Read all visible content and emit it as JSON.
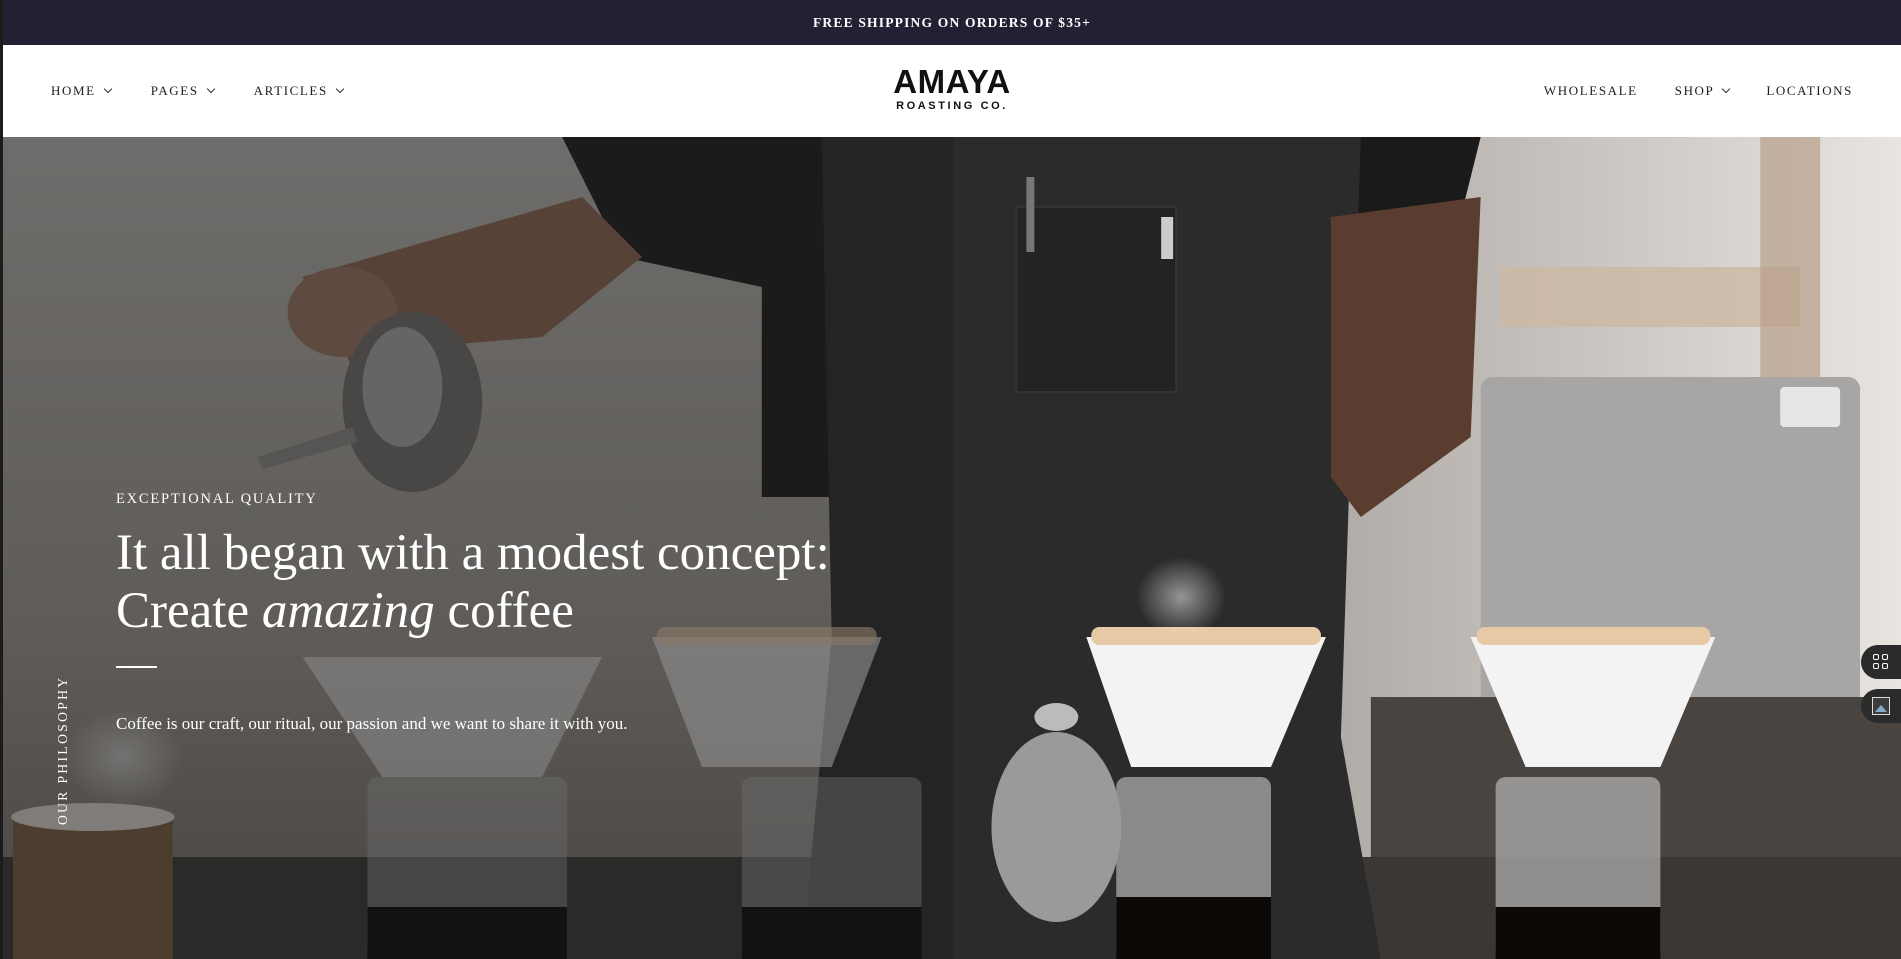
{
  "announcement": {
    "text": "FREE SHIPPING ON ORDERS OF $35+"
  },
  "nav_left": [
    {
      "label": "HOME",
      "has_dropdown": true
    },
    {
      "label": "PAGES",
      "has_dropdown": true
    },
    {
      "label": "ARTICLES",
      "has_dropdown": true
    }
  ],
  "nav_right": [
    {
      "label": "WHOLESALE",
      "has_dropdown": false
    },
    {
      "label": "SHOP",
      "has_dropdown": true
    },
    {
      "label": "LOCATIONS",
      "has_dropdown": false
    }
  ],
  "logo": {
    "name": "AMAYA",
    "tagline": "ROASTING CO."
  },
  "hero": {
    "side_label": "OUR PHILOSOPHY",
    "eyebrow": "EXCEPTIONAL QUALITY",
    "headline_pre": "It all began with a modest concept: Create ",
    "headline_em": "amazing",
    "headline_post": " coffee",
    "subtext": "Coffee is our craft, our ritual, our passion and we want to share it with you."
  },
  "widgets": [
    {
      "icon": "grid-icon"
    },
    {
      "icon": "image-icon"
    }
  ],
  "colors": {
    "announcement_bg": "#222133",
    "header_bg": "#ffffff",
    "text_dark": "#1d1d1d"
  }
}
